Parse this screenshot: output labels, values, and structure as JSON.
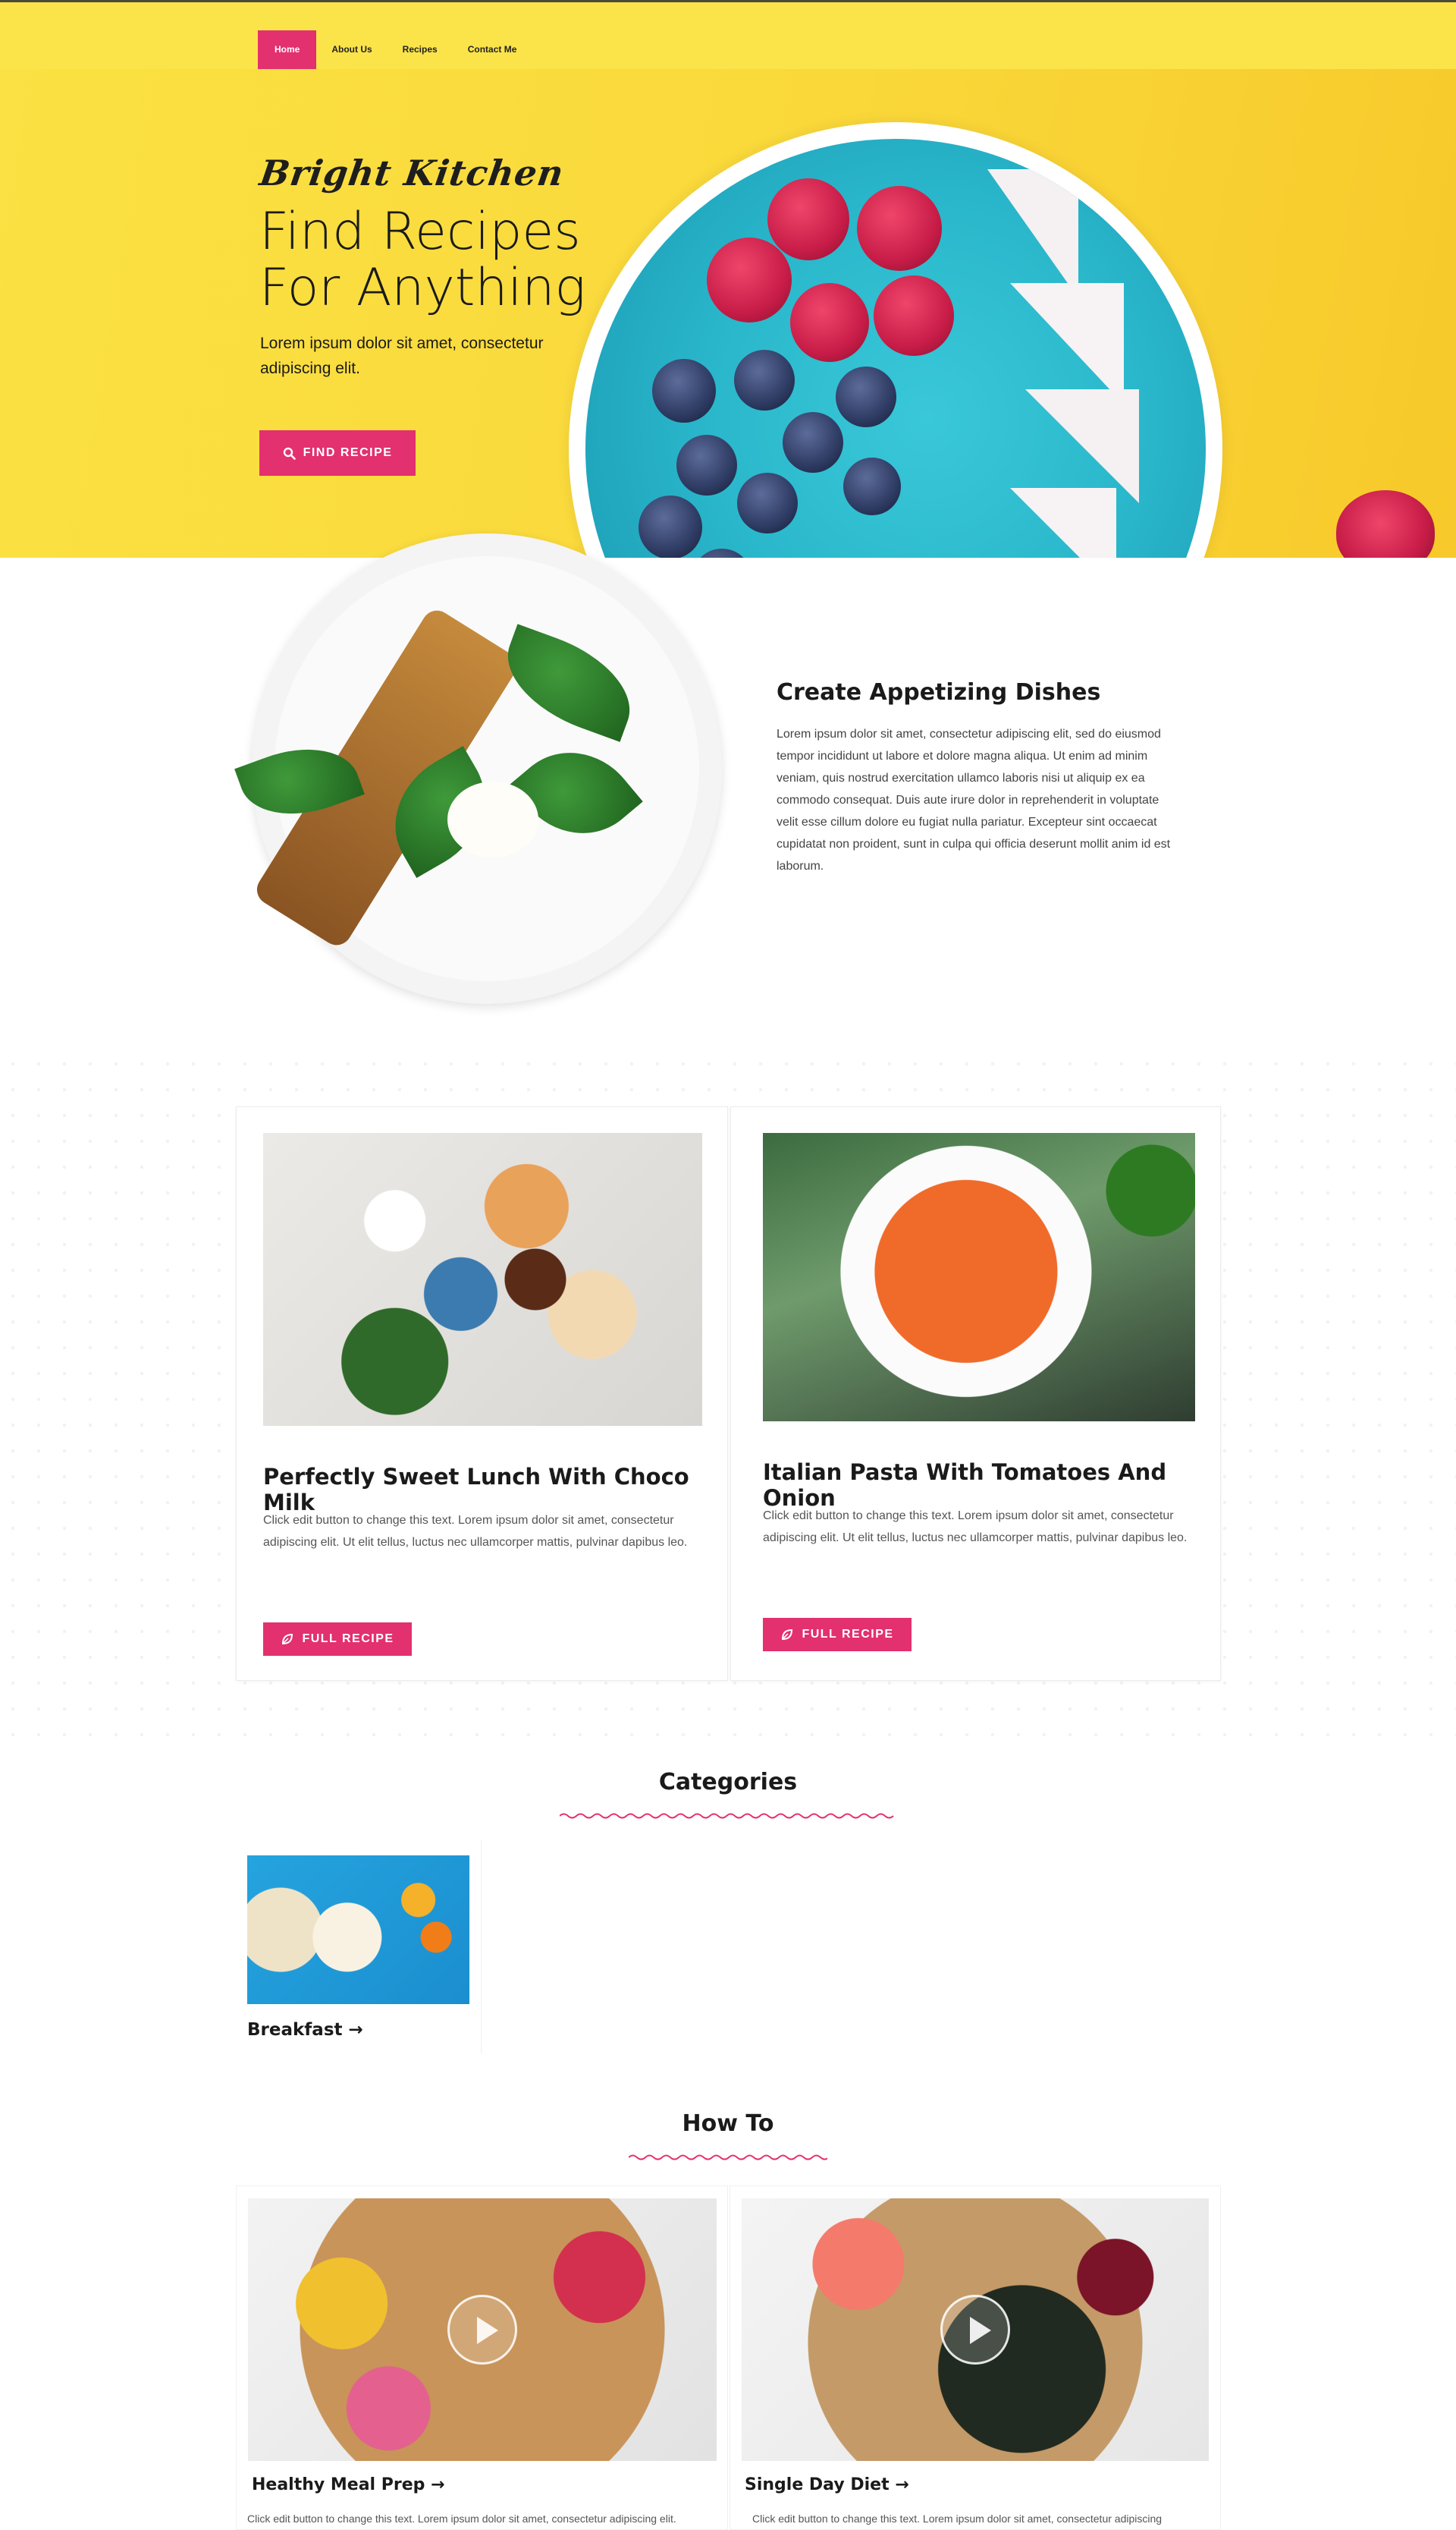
{
  "nav": {
    "items": [
      {
        "label": "Home",
        "active": true
      },
      {
        "label": "About Us",
        "active": false
      },
      {
        "label": "Recipes",
        "active": false
      },
      {
        "label": "Contact Me",
        "active": false
      }
    ]
  },
  "hero": {
    "brand": "Bright Kitchen",
    "title_line1": "Find Recipes",
    "title_line2": "For Anything",
    "subtitle": "Lorem ipsum dolor sit amet, consectetur adipiscing elit.",
    "button_label": "FIND RECIPE",
    "button_icon": "search-icon"
  },
  "feature": {
    "title": "Create Appetizing Dishes",
    "text": "Lorem ipsum dolor sit amet, consectetur adipiscing elit, sed do eiusmod tempor incididunt ut labore et dolore magna aliqua. Ut enim ad minim veniam, quis nostrud exercitation ullamco laboris nisi ut aliquip ex ea commodo consequat. Duis aute irure dolor in reprehenderit in voluptate velit esse cillum dolore eu fugiat nulla pariatur. Excepteur sint occaecat cupidatat non proident, sunt in culpa qui officia deserunt mollit anim id est laborum."
  },
  "recipes": [
    {
      "title": "Perfectly Sweet Lunch With Choco Milk",
      "text": "Click edit button to change this text. Lorem ipsum dolor sit amet, consectetur adipiscing elit. Ut elit tellus, luctus nec ullamcorper mattis, pulvinar dapibus leo.",
      "button_label": "FULL RECIPE"
    },
    {
      "title": "Italian Pasta With Tomatoes And Onion",
      "text": "Click edit button to change this text. Lorem ipsum dolor sit amet, consectetur adipiscing elit. Ut elit tellus, luctus nec ullamcorper mattis, pulvinar dapibus leo.",
      "button_label": "FULL RECIPE"
    }
  ],
  "categories": {
    "title": "Categories",
    "items": [
      {
        "label": "Breakfast →"
      }
    ]
  },
  "howto": {
    "title": "How To",
    "items": [
      {
        "label": "Healthy Meal Prep →",
        "text": "Click edit button to change this text. Lorem ipsum dolor sit amet, consectetur adipiscing elit."
      },
      {
        "label": "Single Day Diet →",
        "text": "Click edit button to change this text. Lorem ipsum dolor sit amet, consectetur adipiscing"
      }
    ]
  },
  "colors": {
    "accent": "#e3306f",
    "nav_bg": "#fbe44a",
    "hero_bg": "#fad83a"
  }
}
